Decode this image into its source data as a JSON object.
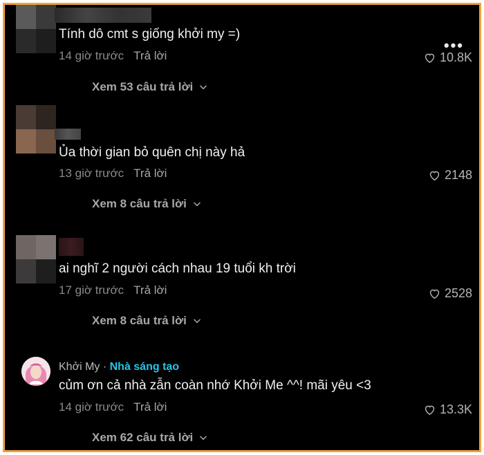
{
  "more_icon": "more-horizontal-icon",
  "comments": [
    {
      "text": "Tính dô cmt s giống khởi my =)",
      "time": "14 giờ trước",
      "reply": "Trả lời",
      "likes": "10.8K",
      "replies": "Xem 53 câu trả lời"
    },
    {
      "text": "Ủa thời gian bỏ quên chị này hả",
      "time": "13 giờ trước",
      "reply": "Trả lời",
      "likes": "2148",
      "replies": "Xem 8 câu trả lời"
    },
    {
      "text": "ai nghĩ 2 người cách nhau 19 tuổi kh trời",
      "time": "17 giờ trước",
      "reply": "Trả lời",
      "likes": "2528",
      "replies": "Xem 8 câu trả lời"
    },
    {
      "author": "Khởi My",
      "separator": " · ",
      "badge": "Nhà sáng tạo",
      "text": "củm ơn cả nhà zẫn coàn nhớ Khởi Me ^^! mãi yêu <3",
      "time": "14 giờ trước",
      "reply": "Trả lời",
      "likes": "13.3K",
      "replies": "Xem 62 câu trả lời"
    }
  ],
  "colors": {
    "background": "#000000",
    "frame_border": "#f0a33a",
    "creator_badge": "#25c6e8",
    "text": "#f1f1f1",
    "muted": "#8a8a8a"
  }
}
